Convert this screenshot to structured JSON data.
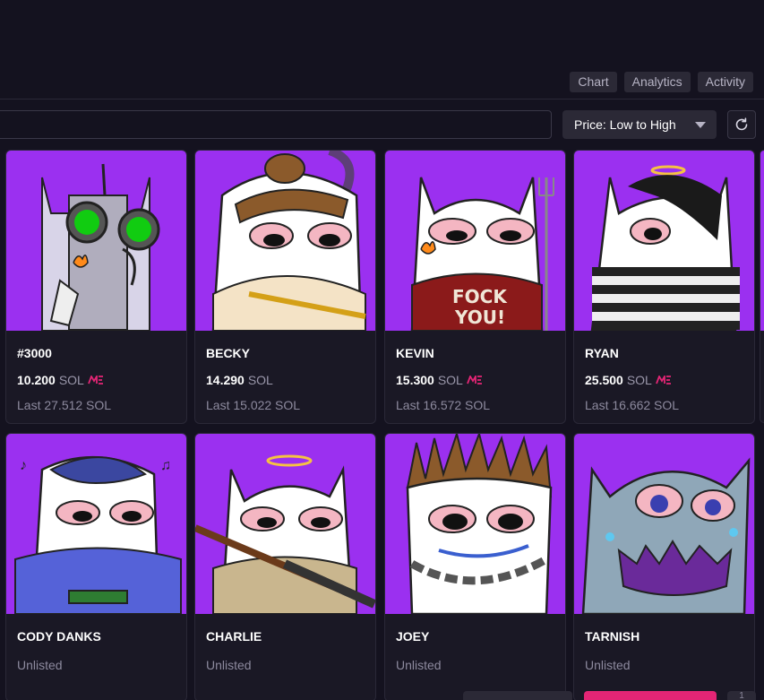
{
  "tabs": [
    {
      "label": "Chart"
    },
    {
      "label": "Analytics"
    },
    {
      "label": "Activity"
    }
  ],
  "search": {
    "value": "",
    "placeholder": ""
  },
  "sort": {
    "selected": "Price: Low to High"
  },
  "currency": "SOL",
  "colors": {
    "art_background": "#9b30f0",
    "brand_accent": "#e42575",
    "background": "#14121f"
  },
  "cards": [
    {
      "name": "#3000",
      "price": "10.200",
      "unit": "SOL",
      "last": "Last 27.512 SOL",
      "character": "robot-helmet"
    },
    {
      "name": "BECKY",
      "price": "14.290",
      "unit": "SOL",
      "last": "Last 15.022 SOL",
      "character": "bun-hair-gun"
    },
    {
      "name": "KEVIN",
      "price": "15.300",
      "unit": "SOL",
      "last": "Last 16.572 SOL",
      "character": "fock-you-sweater",
      "shirt_text_1": "FOCK",
      "shirt_text_2": "YOU!"
    },
    {
      "name": "RYAN",
      "price": "25.500",
      "unit": "SOL",
      "last": "Last 16.662 SOL",
      "character": "emo-halo-striped"
    },
    {
      "name": "CODY DANKS",
      "status": "Unlisted",
      "character": "cap-music"
    },
    {
      "name": "CHARLIE",
      "status": "Unlisted",
      "character": "halo-rifle"
    },
    {
      "name": "JOEY",
      "status": "Unlisted",
      "character": "spiky-chain"
    },
    {
      "name": "TARNISH",
      "status": "Unlisted",
      "character": "zombie-teeth"
    }
  ],
  "footer": {
    "page": "1"
  }
}
